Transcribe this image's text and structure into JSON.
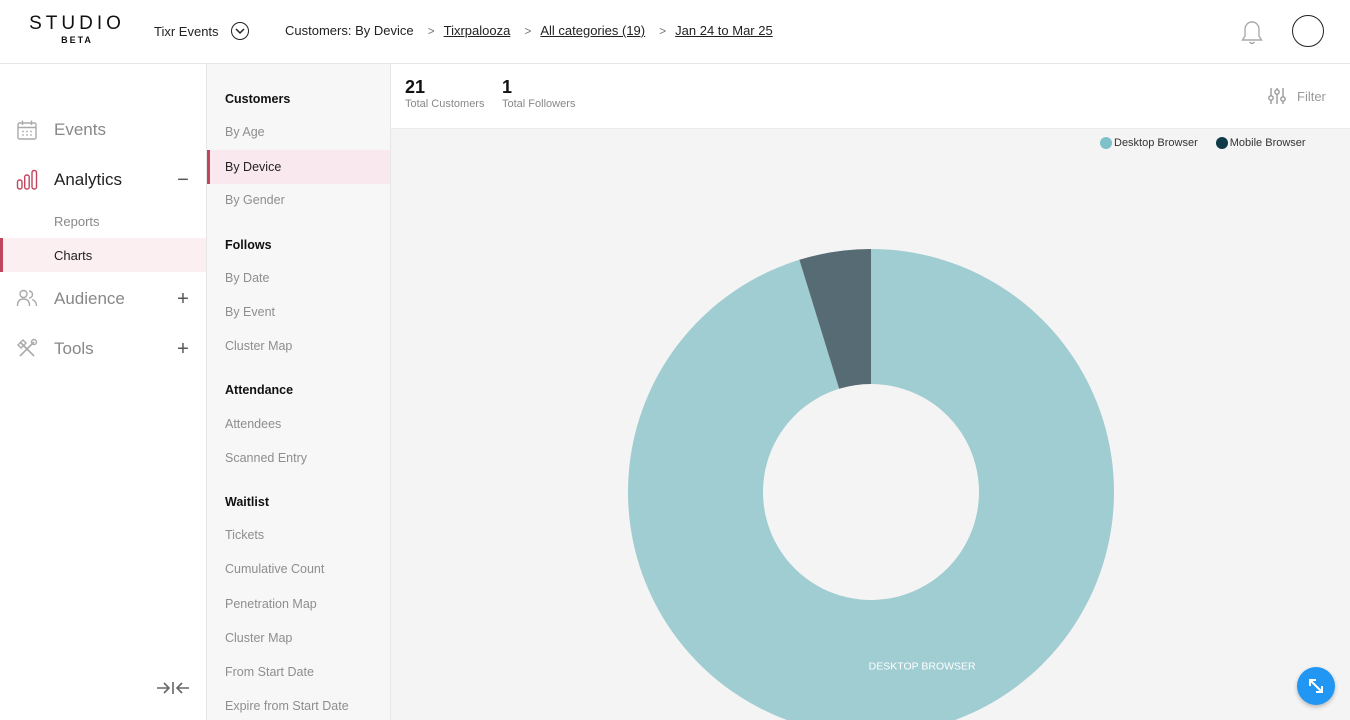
{
  "logo": {
    "main": "STUDIO",
    "sub": "BETA"
  },
  "header": {
    "org_name": "Tixr Events",
    "breadcrumb": {
      "root": "Customers: By Device",
      "sep": ">",
      "event": "Tixrpalooza",
      "categories": "All categories (19)",
      "date_range": "Jan 24 to Mar 25"
    }
  },
  "sidebar": {
    "events": "Events",
    "analytics": "Analytics",
    "analytics_toggle": "−",
    "reports": "Reports",
    "charts": "Charts",
    "audience": "Audience",
    "audience_toggle": "+",
    "tools": "Tools",
    "tools_toggle": "+"
  },
  "submenu": {
    "customers": {
      "title": "Customers",
      "items": [
        "By Age",
        "By Device",
        "By Gender"
      ]
    },
    "follows": {
      "title": "Follows",
      "items": [
        "By Date",
        "By Event",
        "Cluster Map"
      ]
    },
    "attendance": {
      "title": "Attendance",
      "items": [
        "Attendees",
        "Scanned Entry"
      ]
    },
    "waitlist": {
      "title": "Waitlist",
      "items": [
        "Tickets",
        "Cumulative Count",
        "Penetration Map",
        "Cluster Map",
        "From Start Date",
        "Expire from Start Date"
      ]
    }
  },
  "stats": {
    "customers_value": "21",
    "customers_label": "Total Customers",
    "followers_value": "1",
    "followers_label": "Total Followers"
  },
  "filter_label": "Filter",
  "colors": {
    "accent": "#c2455e",
    "desktop": "#a0cdd1",
    "mobile": "#566b73",
    "fab": "#2196f3"
  },
  "chart_data": {
    "type": "pie",
    "donut": true,
    "legend_position": "top-right",
    "series": [
      {
        "name": "Desktop Browser",
        "value": 20,
        "color": "#a0cdd1",
        "legend_color": "#7fc1c8",
        "label": "DESKTOP BROWSER"
      },
      {
        "name": "Mobile Browser",
        "value": 1,
        "color": "#566b73",
        "legend_color": "#0f3a4a",
        "label": ""
      }
    ]
  }
}
